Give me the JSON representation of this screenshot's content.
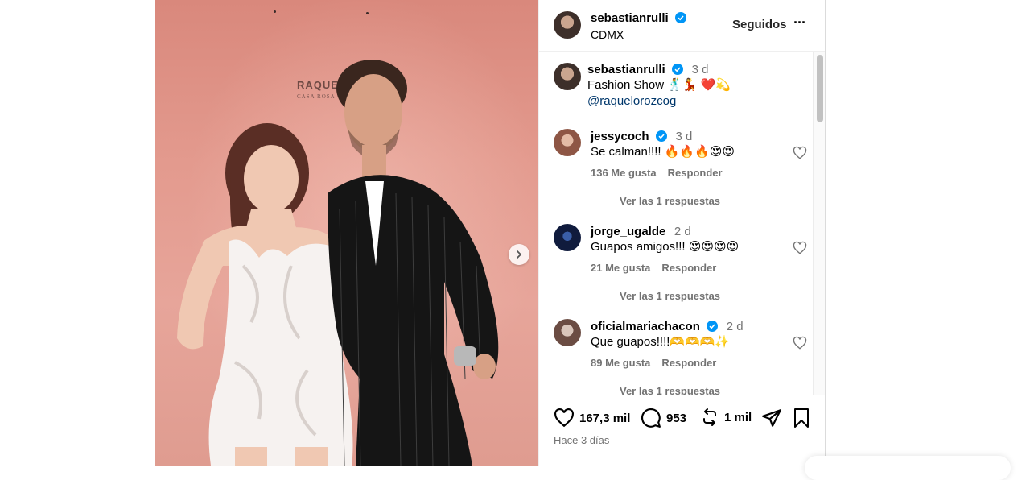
{
  "post": {
    "author": "sebastianrulli",
    "location": "CDMX",
    "follow_state": "Seguidos",
    "more": "···",
    "caption_text": "Fashion Show 🕺💃 ❤️💫",
    "caption_mention": "@raquelorozcog",
    "caption_time": "3 d",
    "brand_text": "RAQUEL",
    "brand_sub": "CASA ROSA"
  },
  "comments": [
    {
      "user": "jessycoch",
      "verified": true,
      "time": "3 d",
      "text": "Se calman!!!! 🔥🔥🔥😍😍",
      "likes": "136 Me gusta",
      "reply": "Responder",
      "view_replies": "Ver las 1 respuestas"
    },
    {
      "user": "jorge_ugalde",
      "verified": false,
      "time": "2 d",
      "text": "Guapos amigos!!! 😍😍😍😍",
      "likes": "21 Me gusta",
      "reply": "Responder",
      "view_replies": "Ver las 1 respuestas"
    },
    {
      "user": "oficialmariachacon",
      "verified": true,
      "time": "2 d",
      "text": "Que guapos!!!!🫶🫶🫶✨",
      "likes": "89 Me gusta",
      "reply": "Responder",
      "view_replies": "Ver las 1 respuestas"
    }
  ],
  "actions": {
    "likes": "167,3 mil",
    "comments": "953",
    "reposts": "1 mil",
    "posted": "Hace 3 días"
  },
  "colors": {
    "verified": "#0095f6",
    "link": "#00376b",
    "muted": "#737373"
  }
}
